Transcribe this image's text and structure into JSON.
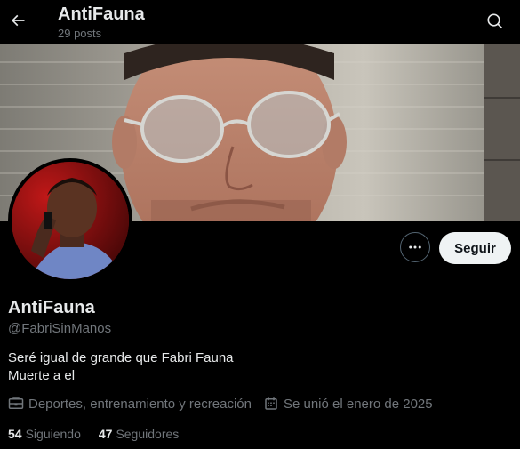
{
  "header": {
    "back_icon": "arrow-left-icon",
    "title": "AntiFauna",
    "post_count": "29 posts",
    "search_icon": "search-icon"
  },
  "banner": {
    "description_icon": "banner-photo"
  },
  "profile": {
    "avatar_icon": "avatar",
    "display_name": "AntiFauna",
    "handle": "@FabriSinManos",
    "bio_lines": [
      "Seré igual de grande que Fabri Fauna",
      "Muerte a el"
    ],
    "category_icon": "briefcase-icon",
    "category": "Deportes, entrenamiento y recreación",
    "joined_icon": "calendar-icon",
    "joined": "Se unió el enero de 2025",
    "following_count": "54",
    "following_label": "Siguiendo",
    "followers_count": "47",
    "followers_label": "Seguidores"
  },
  "actions": {
    "more_icon": "more-dots-icon",
    "follow_label": "Seguir"
  },
  "colors": {
    "background": "#000000",
    "text_primary": "#e7e9ea",
    "text_secondary": "#71767b",
    "follow_button_bg": "#eff3f4",
    "follow_button_text": "#0f1419",
    "border": "#536471"
  }
}
